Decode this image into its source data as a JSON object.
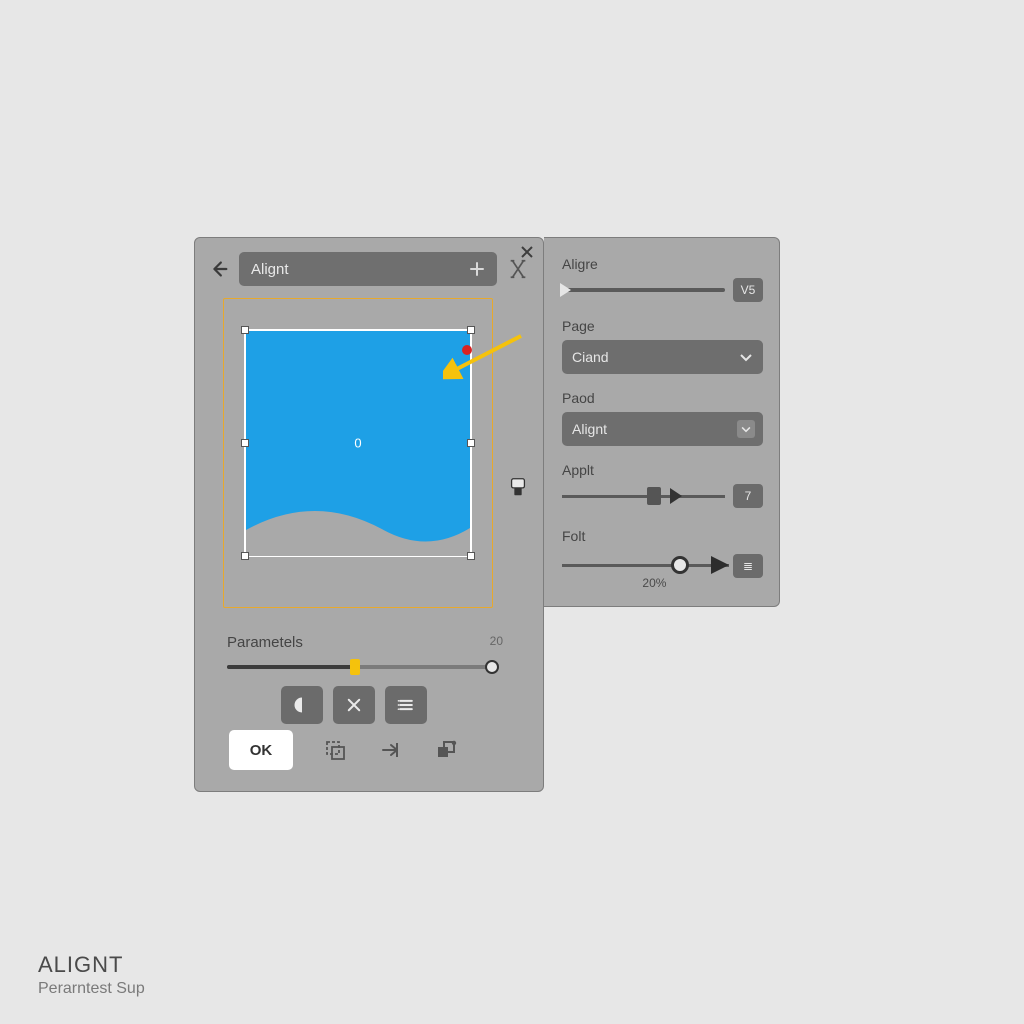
{
  "left_panel": {
    "title": "Alignt",
    "preview": {
      "center_label": "0"
    },
    "parameters_label": "Parametels",
    "parameters_readout": "20",
    "ok_label": "OK"
  },
  "right_panel": {
    "slider1": {
      "label": "Aligre",
      "badge": "V5"
    },
    "dropdown1": {
      "label": "Page",
      "value": "Ciand"
    },
    "dropdown2": {
      "label": "Paod",
      "value": "Alignt"
    },
    "slider2": {
      "label": "Applt",
      "badge": "7"
    },
    "slider3": {
      "label": "Folt",
      "value_label": "20%",
      "badge": "≣"
    }
  },
  "footer": {
    "title": "ALIGNT",
    "subtitle": "Perarntest Sup"
  }
}
